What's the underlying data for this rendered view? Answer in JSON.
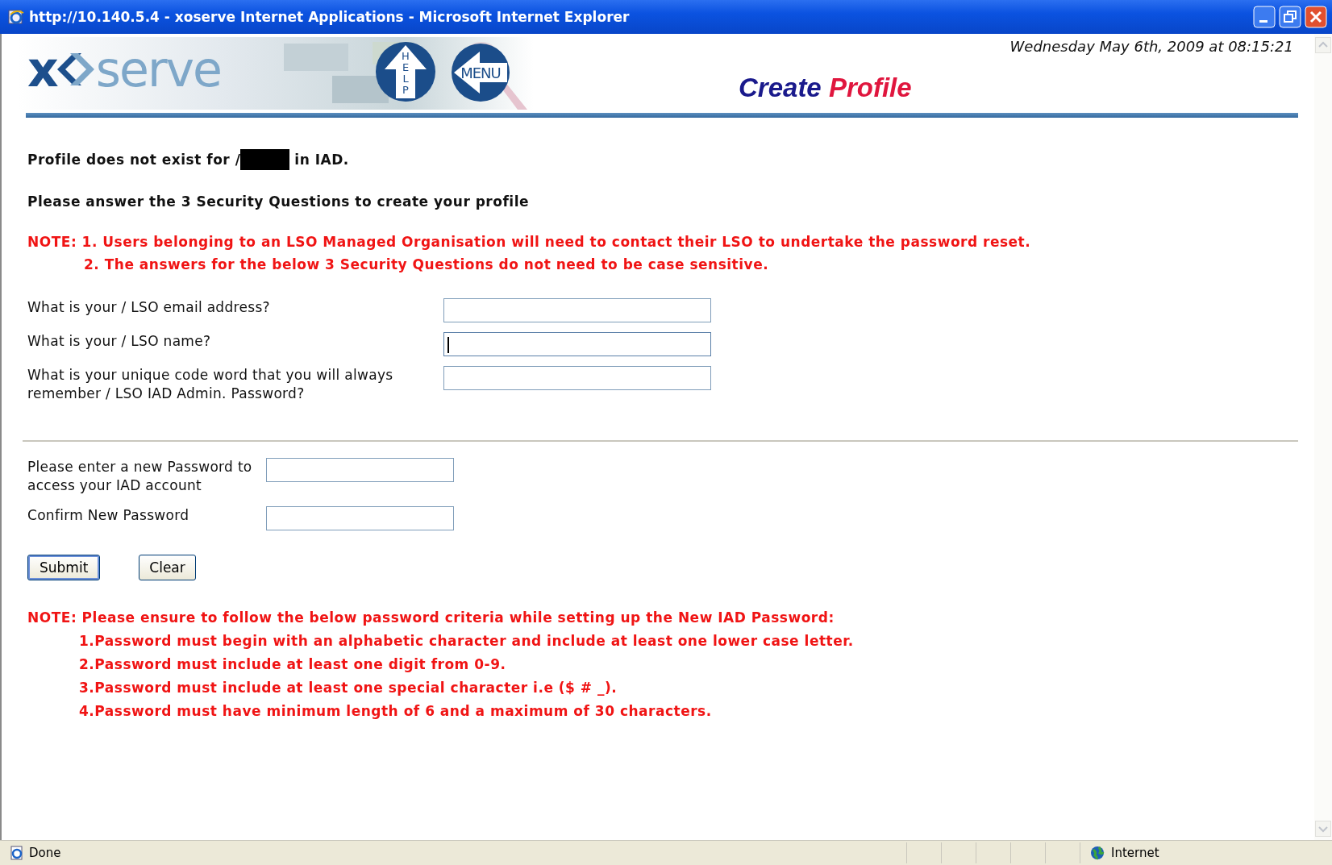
{
  "window": {
    "title": "http://10.140.5.4 - xoserve Internet Applications - Microsoft Internet Explorer"
  },
  "header": {
    "logo_parts": [
      "x",
      "serve"
    ],
    "help_label": "HELP",
    "menu_label": "MENU",
    "datetime": "Wednesday May 6th, 2009 at 08:15:21",
    "title_parts": [
      "Create",
      "Profile"
    ]
  },
  "message_parts": [
    "Profile does not exist for /",
    "in IAD."
  ],
  "instruction": "Please answer the 3 Security Questions to create your profile",
  "notes": [
    {
      "prefix": "NOTE: ",
      "text": "1. Users belonging to an LSO Managed Organisation will need to contact their LSO to undertake the password reset."
    },
    {
      "text": "2. The answers for the below 3 Security Questions do not need to be case sensitive."
    }
  ],
  "questions": [
    {
      "label": "What is your / LSO email address?",
      "focused": false
    },
    {
      "label": "What is your / LSO name?",
      "focused": true
    },
    {
      "label": "What is your unique code word that you will always remember / LSO IAD Admin. Password?",
      "focused": false
    }
  ],
  "password_fields": [
    {
      "label": "Please enter a new Password to access your IAD account",
      "focused": false
    },
    {
      "label": "Confirm New Password",
      "focused": false
    }
  ],
  "buttons": [
    {
      "label": "Submit",
      "default": true
    },
    {
      "label": "Clear",
      "default": false
    }
  ],
  "criteria": {
    "heading": "NOTE: Please ensure to follow the below password criteria while setting up the New IAD Password:",
    "items": [
      "1.Password must begin with an alphabetic character and include at least one lower case letter.",
      "2.Password must include at least one digit from 0-9.",
      "3.Password must include at least one special character i.e ($ # _).",
      "4.Password must have minimum length of 6 and a maximum of 30 characters."
    ]
  },
  "status_bar": {
    "status": "Done",
    "zone": "Internet"
  }
}
